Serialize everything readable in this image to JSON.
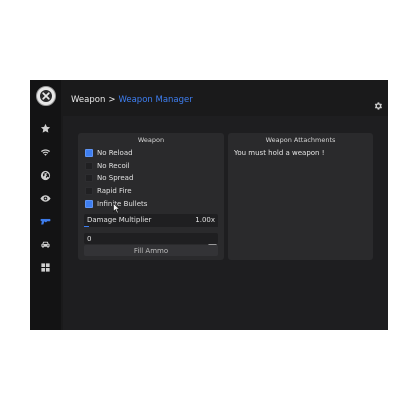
{
  "breadcrumb": {
    "root": "Weapon",
    "separator": ">",
    "current": "Weapon Manager"
  },
  "sidebar": {
    "items": [
      {
        "icon": "star-icon",
        "active": false
      },
      {
        "icon": "wifi-icon",
        "active": false
      },
      {
        "icon": "globe-icon",
        "active": false
      },
      {
        "icon": "eye-icon",
        "active": false
      },
      {
        "icon": "gun-icon",
        "active": true
      },
      {
        "icon": "car-icon",
        "active": false
      },
      {
        "icon": "grid-icon",
        "active": false
      }
    ]
  },
  "weapon_panel": {
    "title": "Weapon",
    "checkboxes": [
      {
        "label": "No Reload",
        "checked": true
      },
      {
        "label": "No Recoil",
        "checked": false
      },
      {
        "label": "No Spread",
        "checked": false
      },
      {
        "label": "Rapid Fire",
        "checked": false
      },
      {
        "label": "Infinite Bullets",
        "checked": true
      }
    ],
    "damage": {
      "label": "Damage Multiplier",
      "value_text": "1.00x",
      "fill_fraction": 0.04
    },
    "ammo": {
      "value": "0"
    },
    "fill_button": "Fill Ammo"
  },
  "attachments_panel": {
    "title": "Weapon Attachments",
    "message": "You must hold a weapon !"
  },
  "colors": {
    "accent": "#3e7ef0",
    "window_bg": "#1a1a1b",
    "panel_bg": "#2a2a2c"
  }
}
